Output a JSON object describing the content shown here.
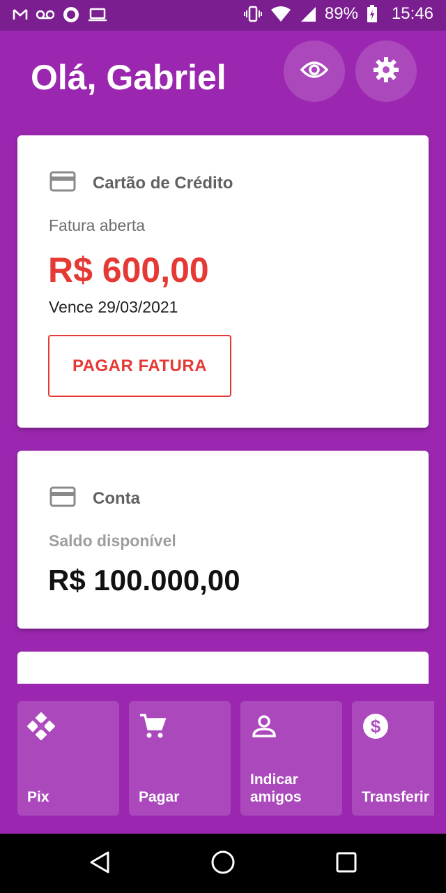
{
  "status_bar": {
    "battery": "89%",
    "time": "15:46",
    "left_icons": [
      "gmail-icon",
      "voicemail-icon",
      "circle-app-icon",
      "laptop-icon"
    ],
    "right_icons": [
      "vibrate-icon",
      "wifi-icon",
      "signal-icon",
      "battery-charging-icon"
    ]
  },
  "header": {
    "greeting": "Olá, Gabriel"
  },
  "credit_card": {
    "title": "Cartão de Crédito",
    "invoice_label": "Fatura aberta",
    "amount": "R$ 600,00",
    "due": "Vence 29/03/2021",
    "pay_button": "PAGAR FATURA",
    "accent": "#e53935"
  },
  "account": {
    "title": "Conta",
    "balance_label": "Saldo disponível",
    "balance": "R$ 100.000,00"
  },
  "actions": [
    {
      "label": "Pix",
      "icon": "pix-icon"
    },
    {
      "label": "Pagar",
      "icon": "cart-icon"
    },
    {
      "label": "Indicar amigos",
      "icon": "person-icon"
    },
    {
      "label": "Transferir",
      "icon": "dollar-icon"
    }
  ],
  "colors": {
    "brand": "#9b27b0",
    "status_bar": "#7b1e8f"
  }
}
